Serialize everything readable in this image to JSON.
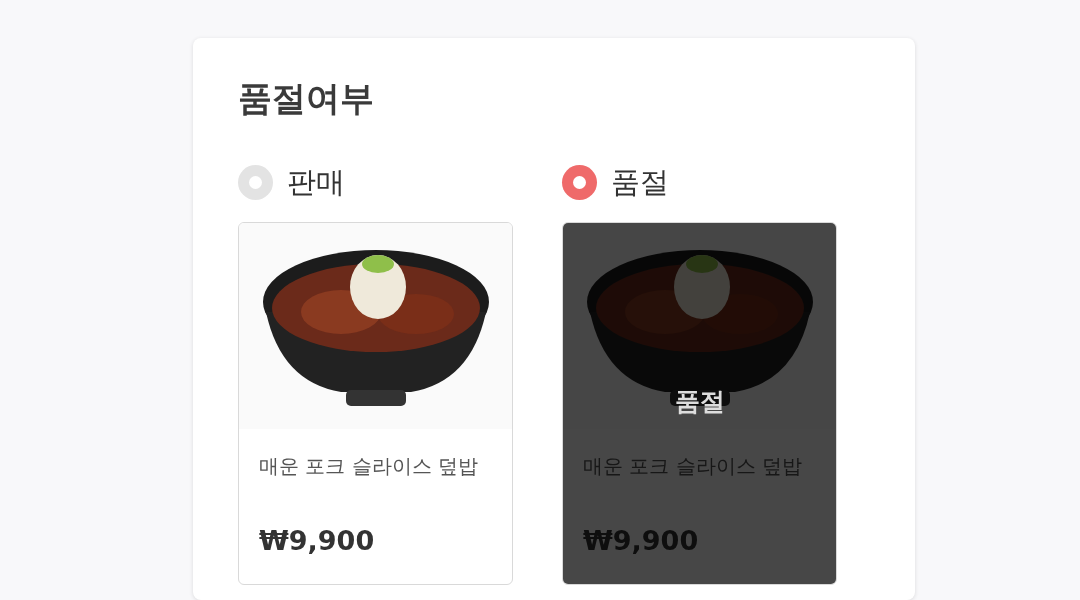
{
  "title": "품절여부",
  "options": [
    {
      "label": "판매",
      "selected": false,
      "product": {
        "name": "매운 포크 슬라이스 덮밥",
        "price": "₩9,900",
        "sold_out": false
      }
    },
    {
      "label": "품절",
      "selected": true,
      "product": {
        "name": "매운 포크 슬라이스 덮밥",
        "price": "₩9,900",
        "sold_out": true,
        "overlay_text": "품절"
      }
    }
  ]
}
